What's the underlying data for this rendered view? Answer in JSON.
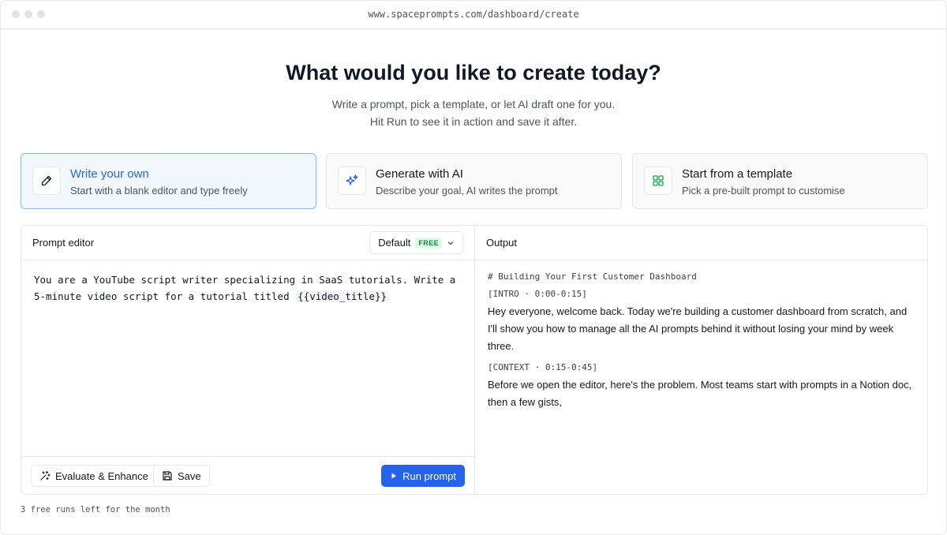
{
  "browser": {
    "url": "www.spaceprompts.com/dashboard/create"
  },
  "hero": {
    "title": "What would you like to create today?",
    "subtitle_line1": "Write a prompt, pick a template, or let AI draft one for you.",
    "subtitle_line2": "Hit Run to see it in action and save it after."
  },
  "modes": [
    {
      "title": "Write your own",
      "desc": "Start with a blank editor and type freely",
      "icon": "pencil-icon",
      "active": true
    },
    {
      "title": "Generate with AI",
      "desc": "Describe your goal, AI writes the prompt",
      "icon": "sparkles-icon",
      "active": false
    },
    {
      "title": "Start from a template",
      "desc": "Pick a pre-built prompt to customise",
      "icon": "grid-icon",
      "active": false
    }
  ],
  "editor": {
    "title": "Prompt editor",
    "model": "Default",
    "model_badge": "FREE",
    "text_before": "You are a YouTube script writer specializing in SaaS tutorials. Write a 5-minute video script for a tutorial titled ",
    "variable": "{{video_title}}",
    "evaluate_label": "Evaluate & Enhance",
    "save_label": "Save",
    "run_label": "Run prompt"
  },
  "output": {
    "title": "Output",
    "heading": "# Building Your First Customer Dashboard",
    "section1_label": "[INTRO · 0:00-0:15]",
    "section1_text": "Hey everyone, welcome back. Today we're building a customer dashboard from scratch, and I'll show you how to manage all the AI prompts behind it without losing your mind by week three.",
    "section2_label": "[CONTEXT · 0:15-0:45]",
    "section2_text": "Before we open the editor, here's the problem. Most teams start with prompts in a Notion doc, then a few gists,"
  },
  "footer": {
    "note": "3 free runs left for the month"
  },
  "colors": {
    "accent": "#2563eb",
    "active_card_bg": "#f3f7fe",
    "active_card_border": "#93b4ef",
    "free_badge": "#15803d"
  }
}
